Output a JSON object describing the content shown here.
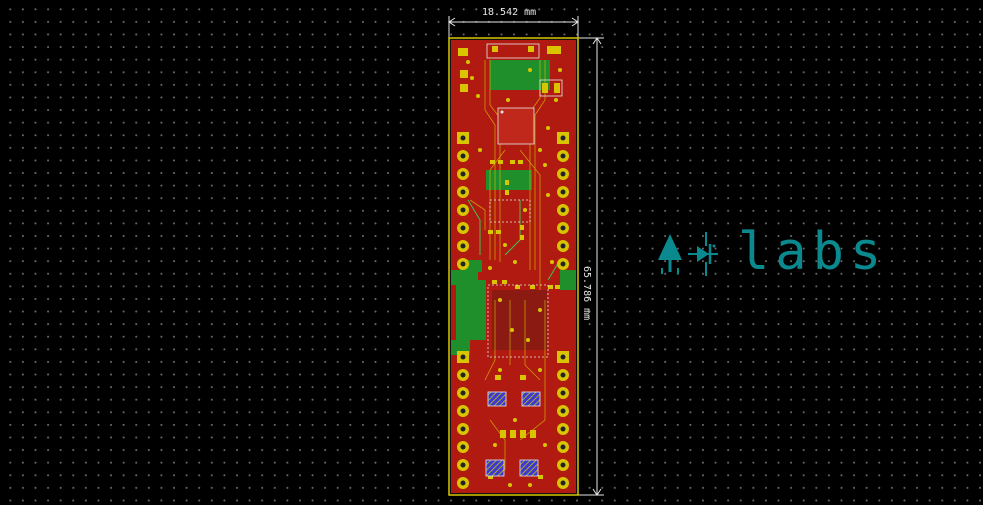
{
  "dimensions": {
    "width_label": "18.542 mm",
    "height_label": "65.786 mm"
  },
  "logo": {
    "text": "labs",
    "icon": "logo-antenna-diode-icon",
    "color": "#0a8a8f"
  },
  "colors": {
    "background": "#000000",
    "grid_dot": "#6a6a6a",
    "copper_top": "#b01a10",
    "copper_bottom": "#1f8f2c",
    "pad": "#d8c400",
    "silkscreen": "#e8e8e8",
    "edge_cut": "#d8c400",
    "dimension": "#e6e6e6"
  }
}
